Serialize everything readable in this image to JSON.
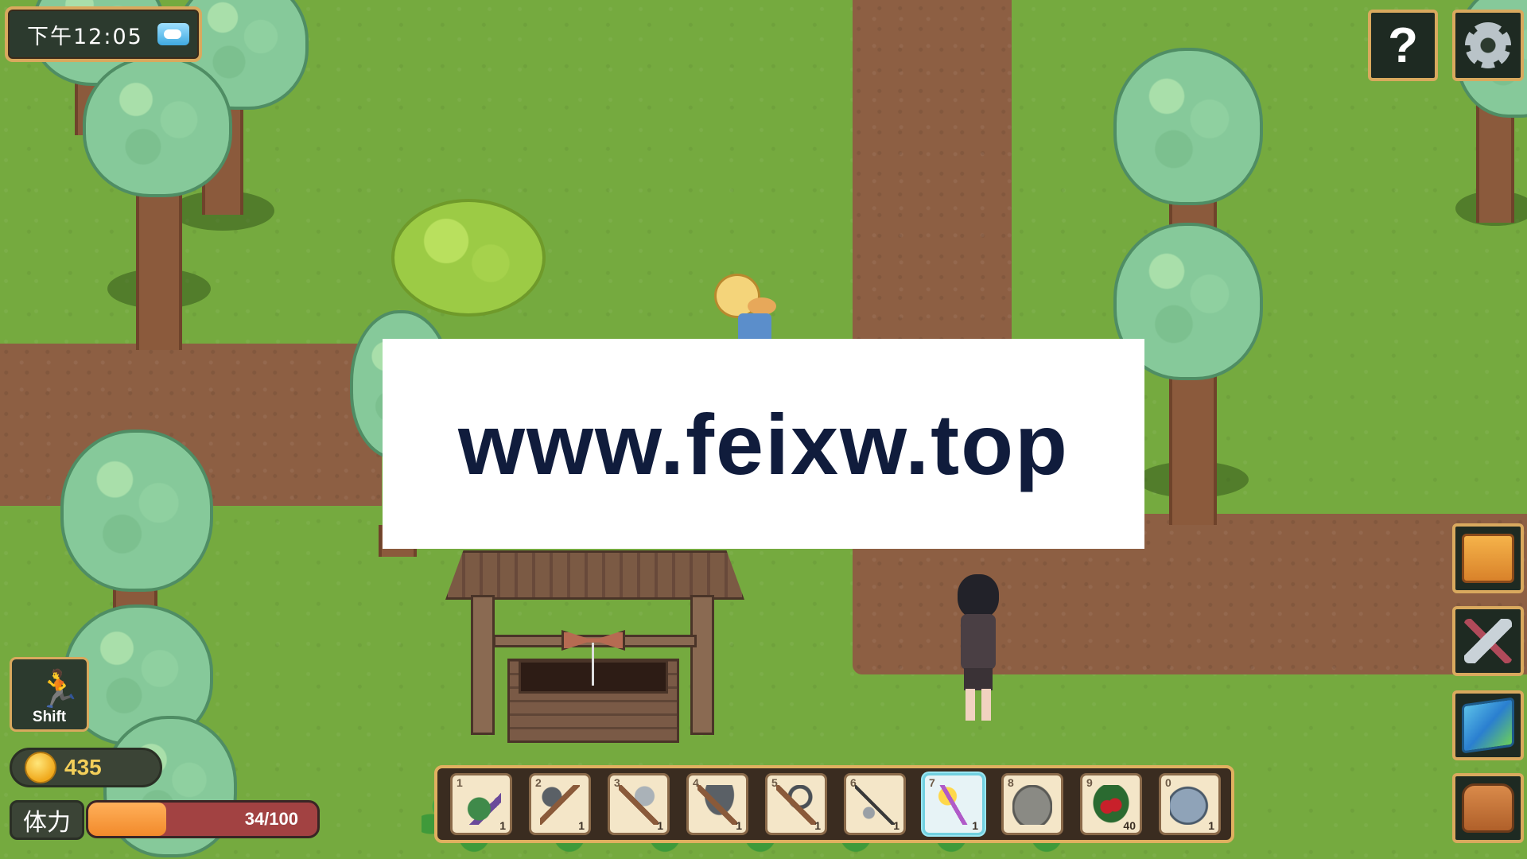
{
  "hud": {
    "time": "下午12:05",
    "weather_icon": "sunny-cloud-icon",
    "help_label": "?",
    "settings_icon": "gear-icon",
    "sprint": {
      "label": "Shift",
      "icon": "running-man-icon"
    },
    "gold": {
      "amount": "435",
      "icon": "gold-coin-icon"
    },
    "stamina": {
      "label": "体力",
      "text": "34/100",
      "current": 34,
      "max": 100
    },
    "side_buttons": [
      {
        "name": "journal",
        "icon": "book-icon"
      },
      {
        "name": "crafting",
        "icon": "hammer-icon"
      },
      {
        "name": "map",
        "icon": "map-icon"
      },
      {
        "name": "inventory",
        "icon": "backpack-icon"
      }
    ]
  },
  "hotbar": {
    "selected_index": 6,
    "slots": [
      {
        "key": "1",
        "item": "watering-can",
        "count": "1"
      },
      {
        "key": "2",
        "item": "hoe",
        "count": "1"
      },
      {
        "key": "3",
        "item": "axe",
        "count": "1"
      },
      {
        "key": "4",
        "item": "pickaxe",
        "count": "1"
      },
      {
        "key": "5",
        "item": "sickle",
        "count": "1"
      },
      {
        "key": "6",
        "item": "fishing-rod",
        "count": "1"
      },
      {
        "key": "7",
        "item": "magic-wand",
        "count": "1"
      },
      {
        "key": "8",
        "item": "stone",
        "count": ""
      },
      {
        "key": "9",
        "item": "holly-berry",
        "count": "40"
      },
      {
        "key": "0",
        "item": "fish",
        "count": "1"
      }
    ]
  },
  "overlay": {
    "watermark": "www.feixw.top"
  },
  "colors": {
    "grass": "#75aa3f",
    "path": "#8d5f43",
    "hud_border": "#d9a95e",
    "stamina_fill": "#f28a2b",
    "stamina_empty": "#a24242",
    "gold_text": "#f3cf5a"
  }
}
